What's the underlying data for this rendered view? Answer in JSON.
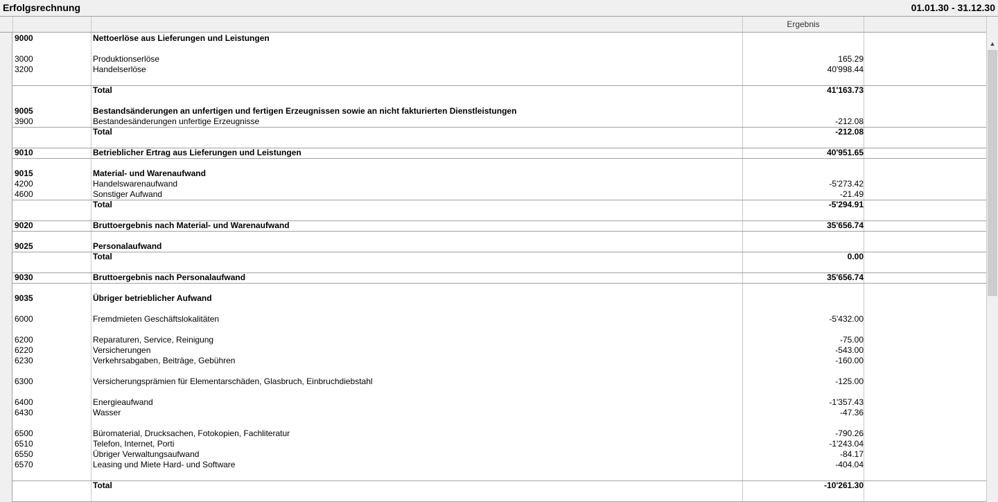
{
  "window": {
    "title": "Erfolgsrechnung",
    "period": "01.01.30 - 31.12.30"
  },
  "table": {
    "columns": [
      "",
      "",
      "Ergebnis",
      ""
    ],
    "rows": [
      {
        "code": "9000",
        "desc": "Nettoerlöse aus Lieferungen und Leistungen",
        "value": "",
        "bold": true
      },
      {
        "code": "",
        "desc": "",
        "value": ""
      },
      {
        "code": "3000",
        "desc": "Produktionserlöse",
        "value": "165.29"
      },
      {
        "code": "3200",
        "desc": "Handelserlöse",
        "value": "40'998.44"
      },
      {
        "code": "",
        "desc": "",
        "value": "",
        "line_after": true
      },
      {
        "code": "",
        "desc": "Total",
        "value": "41'163.73",
        "bold": true
      },
      {
        "code": "",
        "desc": "",
        "value": ""
      },
      {
        "code": "9005",
        "desc": "Bestandsänderungen an unfertigen und fertigen Erzeugnissen sowie an nicht fakturierten Dienstleistungen",
        "value": "",
        "bold": true
      },
      {
        "code": "3900",
        "desc": "Bestandesänderungen unfertige Erzeugnisse",
        "value": "-212.08",
        "line_after": true
      },
      {
        "code": "",
        "desc": "Total",
        "value": "-212.08",
        "bold": true
      },
      {
        "code": "",
        "desc": "",
        "value": "",
        "line_after": true
      },
      {
        "code": "9010",
        "desc": "Betrieblicher Ertrag aus Lieferungen und Leistungen",
        "value": "40'951.65",
        "bold": true,
        "line_after": true
      },
      {
        "code": "",
        "desc": "",
        "value": ""
      },
      {
        "code": "9015",
        "desc": "Material- und Warenaufwand",
        "value": "",
        "bold": true
      },
      {
        "code": "4200",
        "desc": "Handelswarenaufwand",
        "value": "-5'273.42"
      },
      {
        "code": "4600",
        "desc": "Sonstiger Aufwand",
        "value": "-21.49",
        "line_after": true
      },
      {
        "code": "",
        "desc": "Total",
        "value": "-5'294.91",
        "bold": true
      },
      {
        "code": "",
        "desc": "",
        "value": "",
        "line_after": true
      },
      {
        "code": "9020",
        "desc": "Bruttoergebnis nach Material- und Warenaufwand",
        "value": "35'656.74",
        "bold": true,
        "line_after": true
      },
      {
        "code": "",
        "desc": "",
        "value": ""
      },
      {
        "code": "9025",
        "desc": "Personalaufwand",
        "value": "",
        "bold": true,
        "line_after": true
      },
      {
        "code": "",
        "desc": "Total",
        "value": "0.00",
        "bold": true
      },
      {
        "code": "",
        "desc": "",
        "value": "",
        "line_after": true
      },
      {
        "code": "9030",
        "desc": "Bruttoergebnis nach Personalaufwand",
        "value": "35'656.74",
        "bold": true,
        "line_after": true
      },
      {
        "code": "",
        "desc": "",
        "value": ""
      },
      {
        "code": "9035",
        "desc": "Übriger betrieblicher Aufwand",
        "value": "",
        "bold": true
      },
      {
        "code": "",
        "desc": "",
        "value": ""
      },
      {
        "code": "6000",
        "desc": "Fremdmieten Geschäftslokalitäten",
        "value": "-5'432.00"
      },
      {
        "code": "",
        "desc": "",
        "value": ""
      },
      {
        "code": "6200",
        "desc": "Reparaturen, Service, Reinigung",
        "value": "-75.00"
      },
      {
        "code": "6220",
        "desc": "Versicherungen",
        "value": "-543.00"
      },
      {
        "code": "6230",
        "desc": "Verkehrsabgaben, Beiträge, Gebühren",
        "value": "-160.00"
      },
      {
        "code": "",
        "desc": "",
        "value": ""
      },
      {
        "code": "6300",
        "desc": "Versicherungsprämien für Elementarschäden, Glasbruch, Einbruchdiebstahl",
        "value": "-125.00"
      },
      {
        "code": "",
        "desc": "",
        "value": ""
      },
      {
        "code": "6400",
        "desc": "Energieaufwand",
        "value": "-1'357.43"
      },
      {
        "code": "6430",
        "desc": "Wasser",
        "value": "-47.36"
      },
      {
        "code": "",
        "desc": "",
        "value": ""
      },
      {
        "code": "6500",
        "desc": "Büromaterial, Drucksachen, Fotokopien, Fachliteratur",
        "value": "-790.26"
      },
      {
        "code": "6510",
        "desc": "Telefon, Internet, Porti",
        "value": "-1'243.04"
      },
      {
        "code": "6550",
        "desc": "Übriger Verwaltungsaufwand",
        "value": "-84.17"
      },
      {
        "code": "6570",
        "desc": "Leasing und Miete Hard- und Software",
        "value": "-404.04"
      },
      {
        "code": "",
        "desc": "",
        "value": "",
        "line_after": true
      },
      {
        "code": "",
        "desc": "Total",
        "value": "-10'261.30",
        "bold": true
      },
      {
        "code": "",
        "desc": "",
        "value": "",
        "line_after": true
      }
    ]
  },
  "scrollbar": {
    "up_icon": "chevron-up-icon"
  }
}
